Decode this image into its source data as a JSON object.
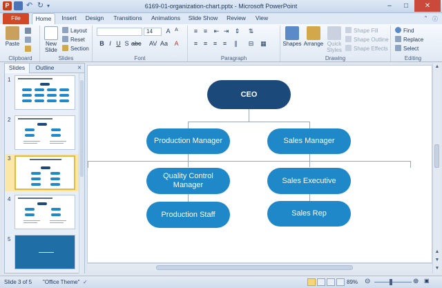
{
  "window": {
    "app_icon": "P",
    "title": "6169-01-organization-chart.pptx - Microsoft PowerPoint",
    "controls": [
      "–",
      "□",
      "✕"
    ]
  },
  "tabs": [
    "File",
    "Home",
    "Insert",
    "Design",
    "Transitions",
    "Animations",
    "Slide Show",
    "Review",
    "View"
  ],
  "ribbon": {
    "clipboard": {
      "paste": "Paste",
      "label": "Clipboard"
    },
    "slides": {
      "new_slide": "New Slide",
      "layout": "Layout",
      "reset": "Reset",
      "section": "Section",
      "label": "Slides"
    },
    "font": {
      "size": "14",
      "label": "Font"
    },
    "paragraph": {
      "label": "Paragraph"
    },
    "drawing": {
      "shapes": "Shapes",
      "arrange": "Arrange",
      "quick_styles": "Quick Styles",
      "shape_fill": "Shape Fill",
      "shape_outline": "Shape Outline",
      "shape_effects": "Shape Effects",
      "label": "Drawing"
    },
    "editing": {
      "find": "Find",
      "replace": "Replace",
      "select": "Select",
      "label": "Editing"
    }
  },
  "pane": {
    "tab_slides": "Slides",
    "tab_outline": "Outline",
    "close": "×",
    "slides": [
      {
        "num": "1"
      },
      {
        "num": "2"
      },
      {
        "num": "3"
      },
      {
        "num": "4"
      },
      {
        "num": "5"
      }
    ]
  },
  "chart": {
    "ceo": "CEO",
    "production_manager": "Production Manager",
    "sales_manager": "Sales Manager",
    "quality_control_manager": "Quality Control Manager",
    "sales_executive": "Sales Executive",
    "production_staff": "Production Staff",
    "sales_rep": "Sales Rep"
  },
  "status": {
    "slide_info": "Slide 3 of 5",
    "theme": "\"Office Theme\"",
    "zoom": "89%",
    "zoom_level_percent": 89
  },
  "colors": {
    "ceo_fill": "#1b4a7a",
    "node_fill": "#1e88c8",
    "file_tab": "#d24726"
  }
}
